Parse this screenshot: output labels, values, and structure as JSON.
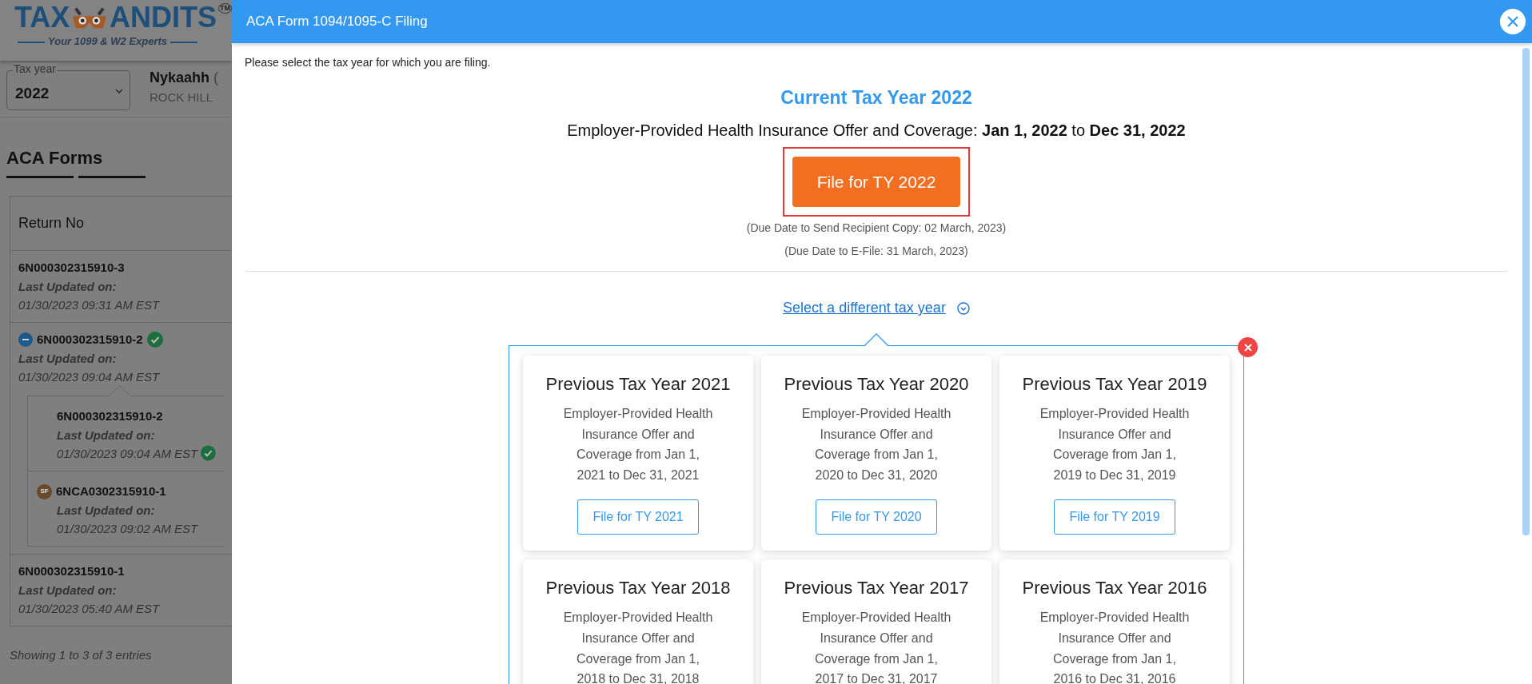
{
  "sidebar": {
    "logo": {
      "left": "TAX",
      "right": "ANDITS",
      "trademark": "TM",
      "tagline": "Your 1099 & W2 Experts"
    },
    "tax_year": {
      "label": "Tax year",
      "value": "2022"
    },
    "business": {
      "name": "Nykaahh",
      "suffix": "(",
      "address": "ROCK HILL"
    },
    "section_title": "ACA Forms",
    "table": {
      "column": "Return No",
      "rows": [
        {
          "return_no": "6N000302315910-3",
          "updated_label": "Last Updated on:",
          "updated_at": "01/30/2023 09:31 AM EST",
          "completed": false,
          "expanded": false
        },
        {
          "return_no": "6N000302315910-2",
          "updated_label": "Last Updated on:",
          "updated_at": "01/30/2023 09:04 AM EST",
          "completed": true,
          "expanded": true,
          "children": [
            {
              "return_no": "6N000302315910-2",
              "updated_label": "Last Updated on:",
              "updated_at": "01/30/2023 09:04 AM EST",
              "completed": true
            },
            {
              "badge": "SF",
              "return_no": "6NCA0302315910-1",
              "updated_label": "Last Updated on:",
              "updated_at": "01/30/2023 09:02 AM EST",
              "completed": false
            }
          ]
        },
        {
          "return_no": "6N000302315910-1",
          "updated_label": "Last Updated on:",
          "updated_at": "01/30/2023 05:40 AM EST",
          "completed": false,
          "expanded": false
        }
      ]
    },
    "footer": "Showing 1 to 3 of 3 entries"
  },
  "modal": {
    "title": "ACA Form 1094/1095-C Filing",
    "intro": "Please select the tax year for which you are filing.",
    "current": {
      "heading": "Current Tax Year 2022",
      "period": "Employer-Provided Health Insurance Offer and Coverage: **Jan 1, 2022** to **Dec 31, 2022**",
      "button": "File for TY 2022",
      "highlighted": true,
      "due_dates": [
        "(Due Date to Send Recipient Copy: 02 March, 2023)",
        "(Due Date to E-File: 31 March, 2023)"
      ]
    },
    "different_year_link": "Select a different tax year",
    "previous_years": [
      {
        "title": "Previous Tax Year 2021",
        "description": "Employer-Provided Health Insurance Offer and Coverage from Jan 1, 2021 to Dec 31, 2021",
        "button": "File for TY 2021"
      },
      {
        "title": "Previous Tax Year 2020",
        "description": "Employer-Provided Health Insurance Offer and Coverage from Jan 1, 2020 to Dec 31, 2020",
        "button": "File for TY 2020"
      },
      {
        "title": "Previous Tax Year 2019",
        "description": "Employer-Provided Health Insurance Offer and Coverage from Jan 1, 2019 to Dec 31, 2019",
        "button": "File for TY 2019"
      },
      {
        "title": "Previous Tax Year 2018",
        "description": "Employer-Provided Health Insurance Offer and Coverage from Jan 1, 2018 to Dec 31, 2018"
      },
      {
        "title": "Previous Tax Year 2017",
        "description": "Employer-Provided Health Insurance Offer and Coverage from Jan 1, 2017 to Dec 31, 2017"
      },
      {
        "title": "Previous Tax Year 2016",
        "description": "Employer-Provided Health Insurance Offer and Coverage from Jan 1, 2016 to Dec 31, 2016"
      }
    ]
  }
}
